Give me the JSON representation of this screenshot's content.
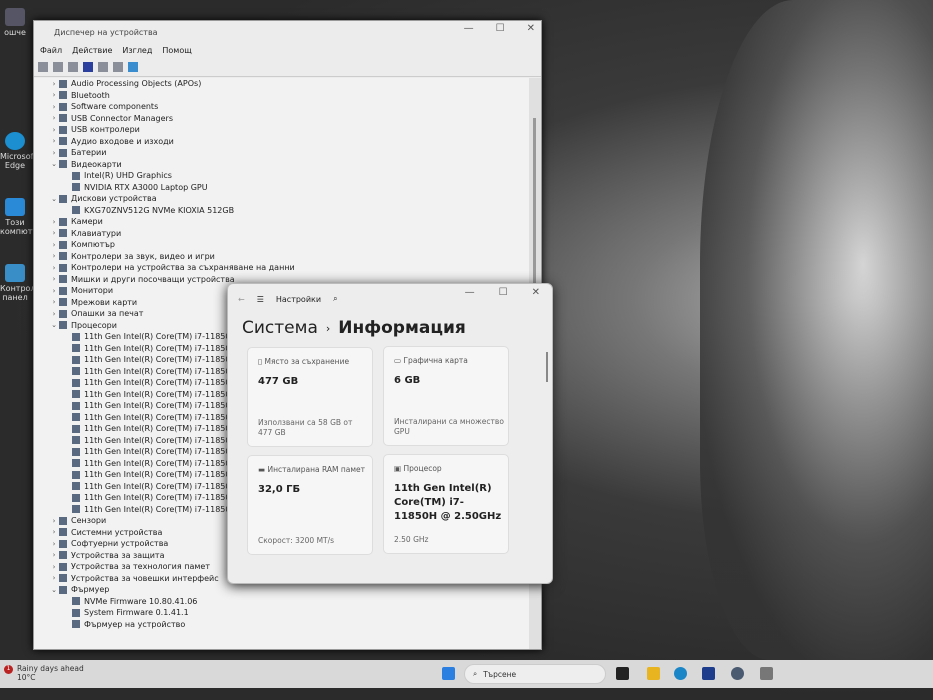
{
  "desktop": {
    "icons": [
      "ошче",
      "Microsoft Edge",
      "Този компютър",
      "Контролен панел"
    ]
  },
  "device_manager": {
    "title": "Диспечер на устройства",
    "menu": [
      "Файл",
      "Действие",
      "Изглед",
      "Помощ"
    ],
    "tree": [
      {
        "label": "Audio Processing Objects (APOs)",
        "level": 0,
        "expanded": false
      },
      {
        "label": "Bluetooth",
        "level": 0,
        "expanded": false
      },
      {
        "label": "Software components",
        "level": 0,
        "expanded": false
      },
      {
        "label": "USB Connector Managers",
        "level": 0,
        "expanded": false
      },
      {
        "label": "USB контролери",
        "level": 0,
        "expanded": false
      },
      {
        "label": "Аудио входове и изходи",
        "level": 0,
        "expanded": false
      },
      {
        "label": "Батерии",
        "level": 0,
        "expanded": false
      },
      {
        "label": "Видеокарти",
        "level": 0,
        "expanded": true
      },
      {
        "label": "Intel(R) UHD Graphics",
        "level": 1
      },
      {
        "label": "NVIDIA RTX A3000 Laptop GPU",
        "level": 1
      },
      {
        "label": "Дискови устройства",
        "level": 0,
        "expanded": true
      },
      {
        "label": "KXG70ZNV512G NVMe KIOXIA 512GB",
        "level": 1
      },
      {
        "label": "Камери",
        "level": 0,
        "expanded": false
      },
      {
        "label": "Клавиатури",
        "level": 0,
        "expanded": false
      },
      {
        "label": "Компютър",
        "level": 0,
        "expanded": false
      },
      {
        "label": "Контролери за звук, видео и игри",
        "level": 0,
        "expanded": false
      },
      {
        "label": "Контролери на устройства за съхраняване на данни",
        "level": 0,
        "expanded": false
      },
      {
        "label": "Мишки и други посочващи устройства",
        "level": 0,
        "expanded": false
      },
      {
        "label": "Монитори",
        "level": 0,
        "expanded": false
      },
      {
        "label": "Мрежови карти",
        "level": 0,
        "expanded": false
      },
      {
        "label": "Опашки за печат",
        "level": 0,
        "expanded": false
      },
      {
        "label": "Процесори",
        "level": 0,
        "expanded": true
      },
      {
        "label": "11th Gen Intel(R) Core(TM) i7-11850H @",
        "level": 1
      },
      {
        "label": "11th Gen Intel(R) Core(TM) i7-11850H @",
        "level": 1
      },
      {
        "label": "11th Gen Intel(R) Core(TM) i7-11850H @",
        "level": 1
      },
      {
        "label": "11th Gen Intel(R) Core(TM) i7-11850H @",
        "level": 1
      },
      {
        "label": "11th Gen Intel(R) Core(TM) i7-11850H @",
        "level": 1
      },
      {
        "label": "11th Gen Intel(R) Core(TM) i7-11850H @",
        "level": 1
      },
      {
        "label": "11th Gen Intel(R) Core(TM) i7-11850H @",
        "level": 1
      },
      {
        "label": "11th Gen Intel(R) Core(TM) i7-11850H @",
        "level": 1
      },
      {
        "label": "11th Gen Intel(R) Core(TM) i7-11850H @",
        "level": 1
      },
      {
        "label": "11th Gen Intel(R) Core(TM) i7-11850H @",
        "level": 1
      },
      {
        "label": "11th Gen Intel(R) Core(TM) i7-11850H @",
        "level": 1
      },
      {
        "label": "11th Gen Intel(R) Core(TM) i7-11850H @",
        "level": 1
      },
      {
        "label": "11th Gen Intel(R) Core(TM) i7-11850H @",
        "level": 1
      },
      {
        "label": "11th Gen Intel(R) Core(TM) i7-11850H @",
        "level": 1
      },
      {
        "label": "11th Gen Intel(R) Core(TM) i7-11850H @",
        "level": 1
      },
      {
        "label": "11th Gen Intel(R) Core(TM) i7-11850H @",
        "level": 1
      },
      {
        "label": "Сензори",
        "level": 0,
        "expanded": false
      },
      {
        "label": "Системни устройства",
        "level": 0,
        "expanded": false
      },
      {
        "label": "Софтуерни устройства",
        "level": 0,
        "expanded": false
      },
      {
        "label": "Устройства за защита",
        "level": 0,
        "expanded": false
      },
      {
        "label": "Устройства за технология памет",
        "level": 0,
        "expanded": false
      },
      {
        "label": "Устройства за човешки интерфейс",
        "level": 0,
        "expanded": false
      },
      {
        "label": "Фърмуер",
        "level": 0,
        "expanded": true
      },
      {
        "label": "NVMe Firmware 10.80.41.06",
        "level": 1
      },
      {
        "label": "System Firmware 0.1.41.1",
        "level": 1
      },
      {
        "label": "Фърмуер на устройство",
        "level": 1
      }
    ]
  },
  "settings": {
    "app": "Настройки",
    "breadcrumb": {
      "parent": "Система",
      "current": "Информация"
    },
    "cards": [
      {
        "label": "Място за съхранение",
        "value": "477 GB",
        "sub": "Използвани са 58 GB от 477 GB"
      },
      {
        "label": "Графична карта",
        "value": "6 GB",
        "sub": "Инсталирани са множество GPU"
      },
      {
        "label": "Инсталирана RAM памет",
        "value": "32,0 ГБ",
        "sub": "Скорост: 3200 MT/s"
      },
      {
        "label": "Процесор",
        "value": "11th Gen Intel(R) Core(TM) i7-11850H @ 2.50GHz",
        "sub": "2.50 GHz"
      }
    ]
  },
  "taskbar": {
    "weather": "Rainy days ahead",
    "temp": "10°C",
    "badge": "1",
    "search_placeholder": "Търсене"
  }
}
